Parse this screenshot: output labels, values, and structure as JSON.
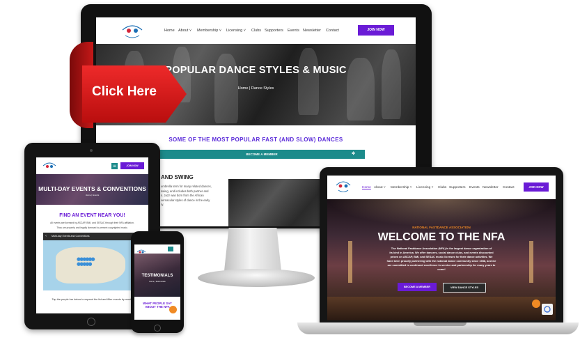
{
  "banner": {
    "click_here": "Click Here"
  },
  "desktop": {
    "nav": {
      "items": [
        "Home",
        "About ˅",
        "Membership ˅",
        "Licensing ˅",
        "Clubs",
        "Supporters",
        "Events",
        "Newsletter",
        "Contact"
      ],
      "join": "JOIN NOW"
    },
    "hero": {
      "title": "POPULAR DANCE STYLES & MUSIC",
      "breadcrumb": "Home  |  Dance Styles"
    },
    "section_title": "SOME OF THE MOST POPULAR FAST (AND SLOW) DANCES",
    "become_member": "BECOME A MEMBER",
    "partial_heading": "AND SWING",
    "partial_text": [
      "umbrella term for many related dances,",
      "swing, and includes both partner and",
      "s. Jazz was born from the African",
      "vernacular styles of dance in the early",
      "ry."
    ]
  },
  "tablet": {
    "join": "JOIN NOW",
    "hero_title": "MULTI-DAY EVENTS & CONVENTIONS",
    "breadcrumb": "Home  |  Events",
    "find_title": "FIND AN EVENT NEAR YOU!",
    "line1": "All events are licensed by ASCAP, BMI, and SESAC through their NFA affiliation.",
    "line2": "They are properly and legally licensed to present copyrighted music.",
    "map_title": "Multi-day Events and Conventions",
    "footer_text": "Tap the purple bar below to expand the list and filter events by month"
  },
  "phone": {
    "hero_title": "TESTIMONIALS",
    "breadcrumb": "Home  |  Testimonials",
    "what_line1": "WHAT PEOPLE SAY",
    "what_line2": "ABOUT THE NFA"
  },
  "laptop": {
    "nav": {
      "items": [
        "Home",
        "About ˅",
        "Membership ˅",
        "Licensing ˅",
        "Clubs",
        "Supporters",
        "Events",
        "Newsletter",
        "Contact"
      ],
      "join": "JOIN NOW"
    },
    "org_label": "NATIONAL FASTDANCE ASSOCIATION",
    "welcome": "WELCOME TO THE NFA",
    "body_lines": [
      "The National Fastdance Association (NFA) is the largest dance organization of",
      "its kind in America. We offer dancers, social dance clubs, and events discounted",
      "prices on ASCAP, BMI, and SESAC music licenses for their dance activities. We",
      "have been proudly partnering with the national dance community since 1988, and we",
      "are committed to continued excellence in service and partnership for many years to",
      "come!"
    ],
    "btn_member": "BECOME A MEMBER",
    "btn_styles": "VIEW DANCE STYLES"
  },
  "colors": {
    "purple": "#6a1bd6",
    "teal": "#1c8b8b",
    "red": "#d41414",
    "orange": "#f08a24"
  },
  "icons": [
    "nfa-logo",
    "chat-bubble-icon",
    "recaptcha-icon",
    "map-pin-icons",
    "hamburger-icon"
  ]
}
